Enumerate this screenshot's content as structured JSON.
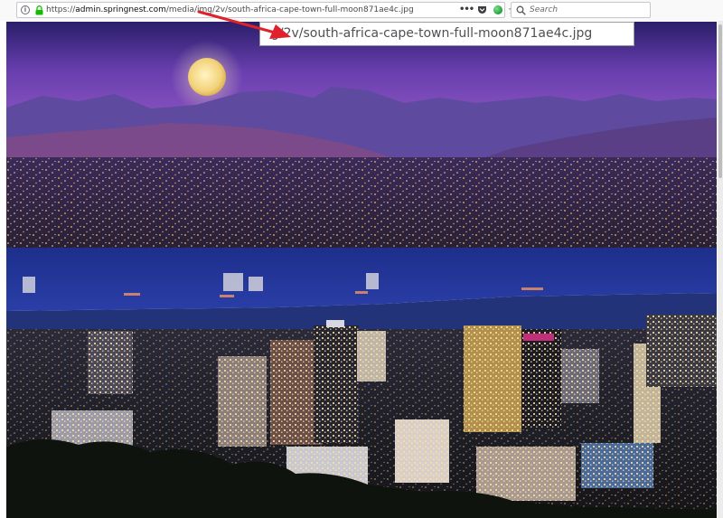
{
  "browser": {
    "url": {
      "scheme": "https://",
      "domain": "admin.springnest.com",
      "path": "/media/img/2v/south-africa-cape-town-full-moon871ae4c.jpg"
    },
    "search": {
      "placeholder": "Search"
    },
    "icons": [
      "info-icon",
      "lock-icon",
      "more-icon",
      "pocket-icon",
      "extension-icon",
      "star-icon",
      "search-icon"
    ]
  },
  "annotation": {
    "zoom_text": "g/2v/south-africa-cape-town-full-moon871ae4c.jpg",
    "arrow_color": "#e0202a"
  },
  "image": {
    "alt": "south-africa-cape-town-full-moon871ae4c.jpg"
  }
}
